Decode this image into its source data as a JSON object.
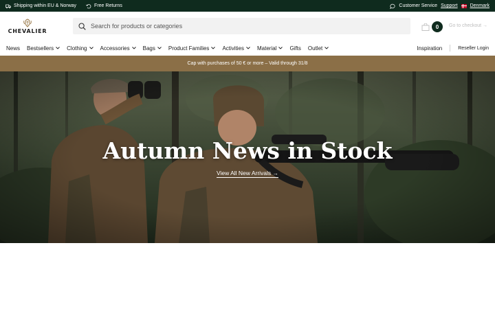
{
  "topbar": {
    "shipping": "Shipping within EU & Norway",
    "returns": "Free Returns",
    "customer_service": "Customer Service",
    "support": "Support",
    "country": "Denmark"
  },
  "header": {
    "logo_text": "CHEVALIER",
    "search_placeholder": "Search for products or categories",
    "cart_count": "0",
    "checkout_label": "Go to checkout →"
  },
  "nav": {
    "items": [
      {
        "label": "News",
        "dropdown": false
      },
      {
        "label": "Bestsellers",
        "dropdown": true
      },
      {
        "label": "Clothing",
        "dropdown": true
      },
      {
        "label": "Accessories",
        "dropdown": true
      },
      {
        "label": "Bags",
        "dropdown": true
      },
      {
        "label": "Product Families",
        "dropdown": true
      },
      {
        "label": "Activities",
        "dropdown": true
      },
      {
        "label": "Material",
        "dropdown": true
      },
      {
        "label": "Gifts",
        "dropdown": false
      },
      {
        "label": "Outlet",
        "dropdown": true
      }
    ],
    "inspiration": "Inspiration",
    "reseller_login": "Reseller Login"
  },
  "promo": {
    "text": "Cap with purchases of 50 € or more – Valid through 31/8"
  },
  "hero": {
    "title": "Autumn News in Stock",
    "link": "View All New Arrivals →"
  },
  "colors": {
    "topbar_bg": "#0f2b1e",
    "promo_bg": "#8b6f47",
    "cart_badge": "#0f2b1e"
  }
}
